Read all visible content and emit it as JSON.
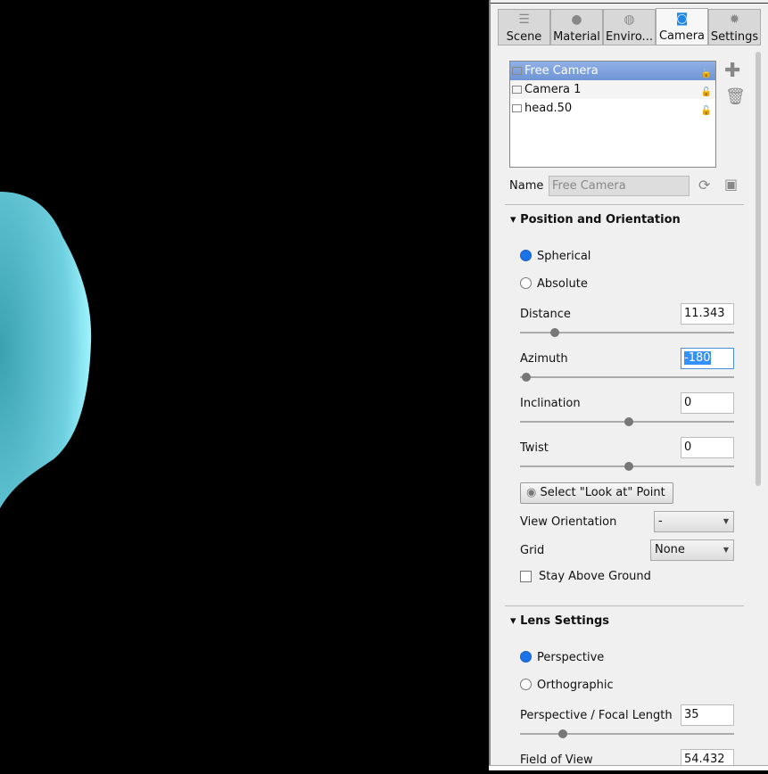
{
  "tabs": [
    {
      "label": "Scene",
      "icon": "list-icon"
    },
    {
      "label": "Material",
      "icon": "sphere-icon"
    },
    {
      "label": "Enviro...",
      "icon": "globe-icon"
    },
    {
      "label": "Camera",
      "icon": "camera-icon",
      "active": true
    },
    {
      "label": "Settings",
      "icon": "gear-icon"
    }
  ],
  "cameras": [
    {
      "label": "Free Camera",
      "selected": true
    },
    {
      "label": "Camera 1"
    },
    {
      "label": "head.50"
    }
  ],
  "name": {
    "label": "Name",
    "placeholder": "Free Camera"
  },
  "position": {
    "title": "Position and Orientation",
    "spherical": "Spherical",
    "absolute": "Absolute",
    "distance": {
      "label": "Distance",
      "value": "11.343",
      "slider": 0.14
    },
    "azimuth": {
      "label": "Azimuth",
      "value": "-180",
      "slider": 0.0
    },
    "inclination": {
      "label": "Inclination",
      "value": "0",
      "slider": 0.5
    },
    "twist": {
      "label": "Twist",
      "value": "0",
      "slider": 0.5
    },
    "look_at": "Select \"Look at\" Point",
    "view_orientation": {
      "label": "View Orientation",
      "value": "-"
    },
    "grid": {
      "label": "Grid",
      "value": "None"
    },
    "stay_above": "Stay Above Ground"
  },
  "lens": {
    "title": "Lens Settings",
    "perspective": "Perspective",
    "orthographic": "Orthographic",
    "focal": {
      "label": "Perspective / Focal Length",
      "value": "35",
      "slider": 0.18
    },
    "fov": {
      "label": "Field of View",
      "value": "54.432"
    }
  },
  "colors": {
    "accent": "#1a73e8",
    "selection": "#7a9fdc",
    "object": "#7fe8f5"
  }
}
